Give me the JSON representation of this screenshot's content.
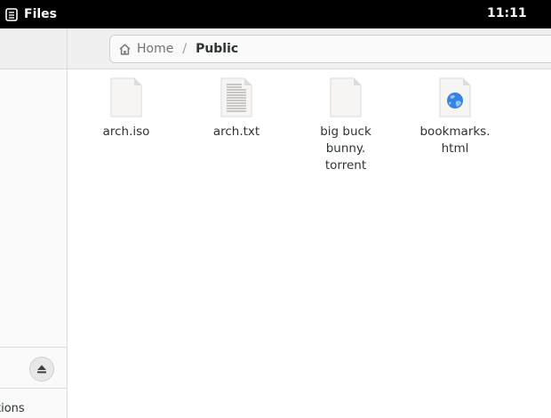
{
  "topbar": {
    "app_name": "Files",
    "app_icon": "files-app-icon",
    "clock": "11:11"
  },
  "pathbar": {
    "home_label": "Home",
    "home_icon": "home-icon",
    "separator": "/",
    "current": "Public"
  },
  "sidebar": {
    "partial_item_label": "tions",
    "eject_icon": "eject-icon"
  },
  "files": [
    {
      "name": "arch.iso",
      "icon": "generic-file-icon"
    },
    {
      "name": "arch.txt",
      "icon": "text-file-icon"
    },
    {
      "name": "big buck bunny. torrent",
      "line1": "big buck",
      "line2": "bunny.",
      "line3": "torrent",
      "icon": "generic-file-icon"
    },
    {
      "name": "bookmarks. html",
      "line1": "bookmarks.",
      "line2": "html",
      "icon": "html-file-icon"
    }
  ]
}
